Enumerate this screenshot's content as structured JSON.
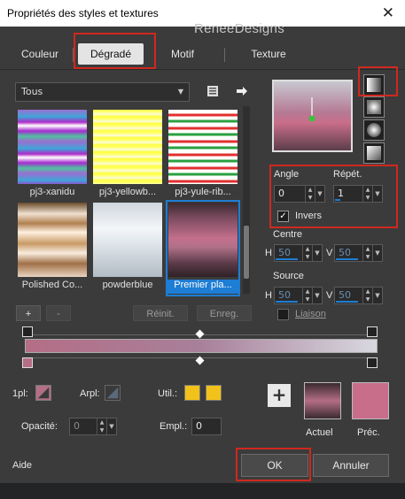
{
  "window": {
    "title": "Propriétés des styles et textures",
    "close_glyph": "✕"
  },
  "watermark": "ReneeDesigns",
  "tabs": [
    {
      "label": "Couleur",
      "active": false
    },
    {
      "label": "Dégradé",
      "active": true
    },
    {
      "label": "Motif",
      "active": false
    },
    {
      "label": "Texture",
      "active": false
    }
  ],
  "category_select": {
    "value": "Tous",
    "arrow": "▼"
  },
  "icons": {
    "library": "book-icon",
    "arrow": "right-arrow-icon"
  },
  "gradients": [
    {
      "label": "pj3-xanidu",
      "selected": false
    },
    {
      "label": "pj3-yellowb...",
      "selected": false
    },
    {
      "label": "pj3-yule-rib...",
      "selected": false
    },
    {
      "label": "Polished Co...",
      "selected": false
    },
    {
      "label": "powderblue",
      "selected": false
    },
    {
      "label": "Premier pla...",
      "selected": true
    }
  ],
  "edit_buttons": {
    "add": "+",
    "remove": "-",
    "reset": "Réinit.",
    "save": "Enreg."
  },
  "angle": {
    "label": "Angle",
    "value": "0"
  },
  "repeat": {
    "label": "Répét.",
    "value": "1"
  },
  "invert": {
    "label": "Invers",
    "checked": true
  },
  "centre": {
    "label": "Centre",
    "h_label": "H",
    "h_value": "50",
    "v_label": "V",
    "v_value": "50"
  },
  "source": {
    "label": "Source",
    "h_label": "H",
    "h_value": "50",
    "v_label": "V",
    "v_value": "50"
  },
  "link": {
    "label": "Liaison",
    "checked": false
  },
  "stop_props": {
    "stop_label": "1pl:",
    "background_label": "Arpl:",
    "use_label": "Util.:",
    "opacity_label": "Opacité:",
    "opacity_value": "0",
    "position_label": "Empl.:",
    "position_value": "0"
  },
  "colors": {
    "current_label": "Actuel",
    "previous_label": "Préc.",
    "current": "#b46e86",
    "previous": "#c96e8a",
    "use_swatch": "#f2c21a"
  },
  "footer": {
    "help": "Aide",
    "ok": "OK",
    "cancel": "Annuler"
  }
}
